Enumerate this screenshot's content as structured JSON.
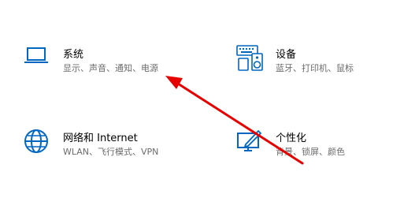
{
  "tiles": [
    {
      "title": "系统",
      "desc": "显示、声音、通知、电源",
      "icon": "laptop-icon"
    },
    {
      "title": "设备",
      "desc": "蓝牙、打印机、鼠标",
      "icon": "keyboard-speaker-icon"
    },
    {
      "title": "网络和 Internet",
      "desc": "WLAN、飞行模式、VPN",
      "icon": "globe-icon"
    },
    {
      "title": "个性化",
      "desc": "背景、锁屏、颜色",
      "icon": "monitor-pen-icon"
    }
  ],
  "colors": {
    "icon": "#0067c0",
    "title": "#000000",
    "desc": "#6b6b6b",
    "arrow": "#e60000"
  }
}
